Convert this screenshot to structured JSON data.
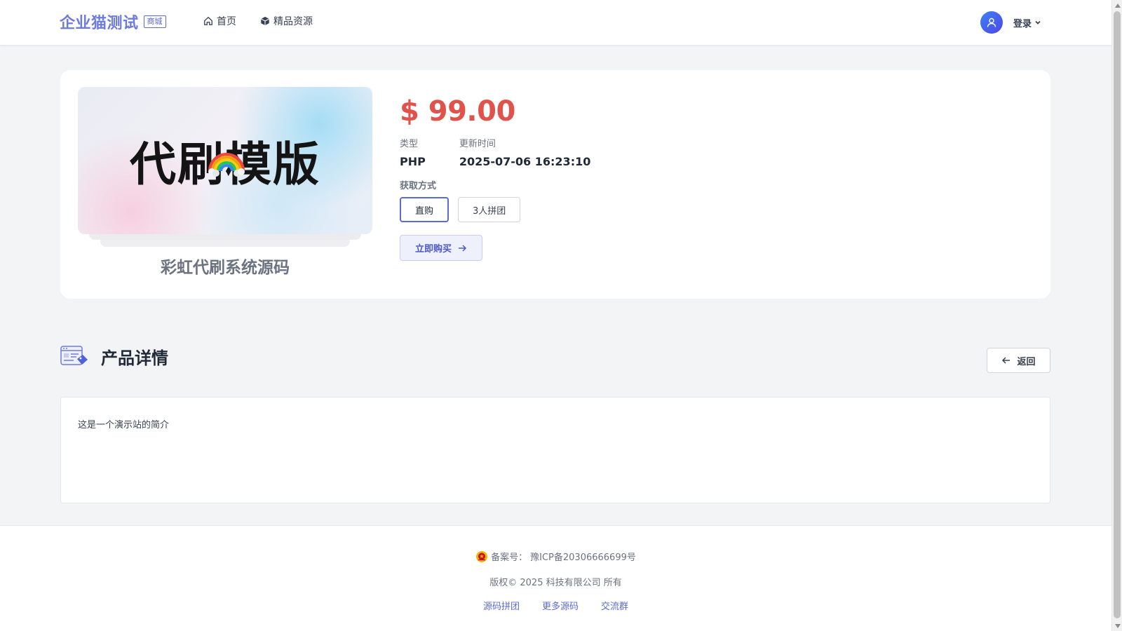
{
  "header": {
    "brand_name": "企业猫测试",
    "brand_badge": "商城",
    "nav": [
      {
        "label": "首页",
        "icon": "home-icon"
      },
      {
        "label": "精品资源",
        "icon": "cube-icon"
      }
    ],
    "login_label": "登录"
  },
  "product": {
    "cover_text": "代刷模版",
    "name": "彩虹代刷系统源码",
    "price": "$ 99.00",
    "type_label": "类型",
    "type_value": "PHP",
    "updated_label": "更新时间",
    "updated_value": "2025-07-06 16:23:10",
    "method_label": "获取方式",
    "options": [
      {
        "label": "直购",
        "selected": true
      },
      {
        "label": "3人拼团",
        "selected": false
      }
    ],
    "buy_label": "立即购买"
  },
  "details": {
    "title": "产品详情",
    "back_label": "返回",
    "content": "这是一个演示站的简介"
  },
  "footer": {
    "icp_prefix": "备案号：",
    "icp_number": "豫ICP备20306666699号",
    "copyright": "版权© 2025 科技有限公司 所有",
    "links": [
      "源码拼团",
      "更多源码",
      "交流群"
    ]
  },
  "colors": {
    "accent": "#5b6bd5",
    "brand": "#6d7ae0",
    "price": "#e0534a",
    "background": "#f3f4f6"
  }
}
